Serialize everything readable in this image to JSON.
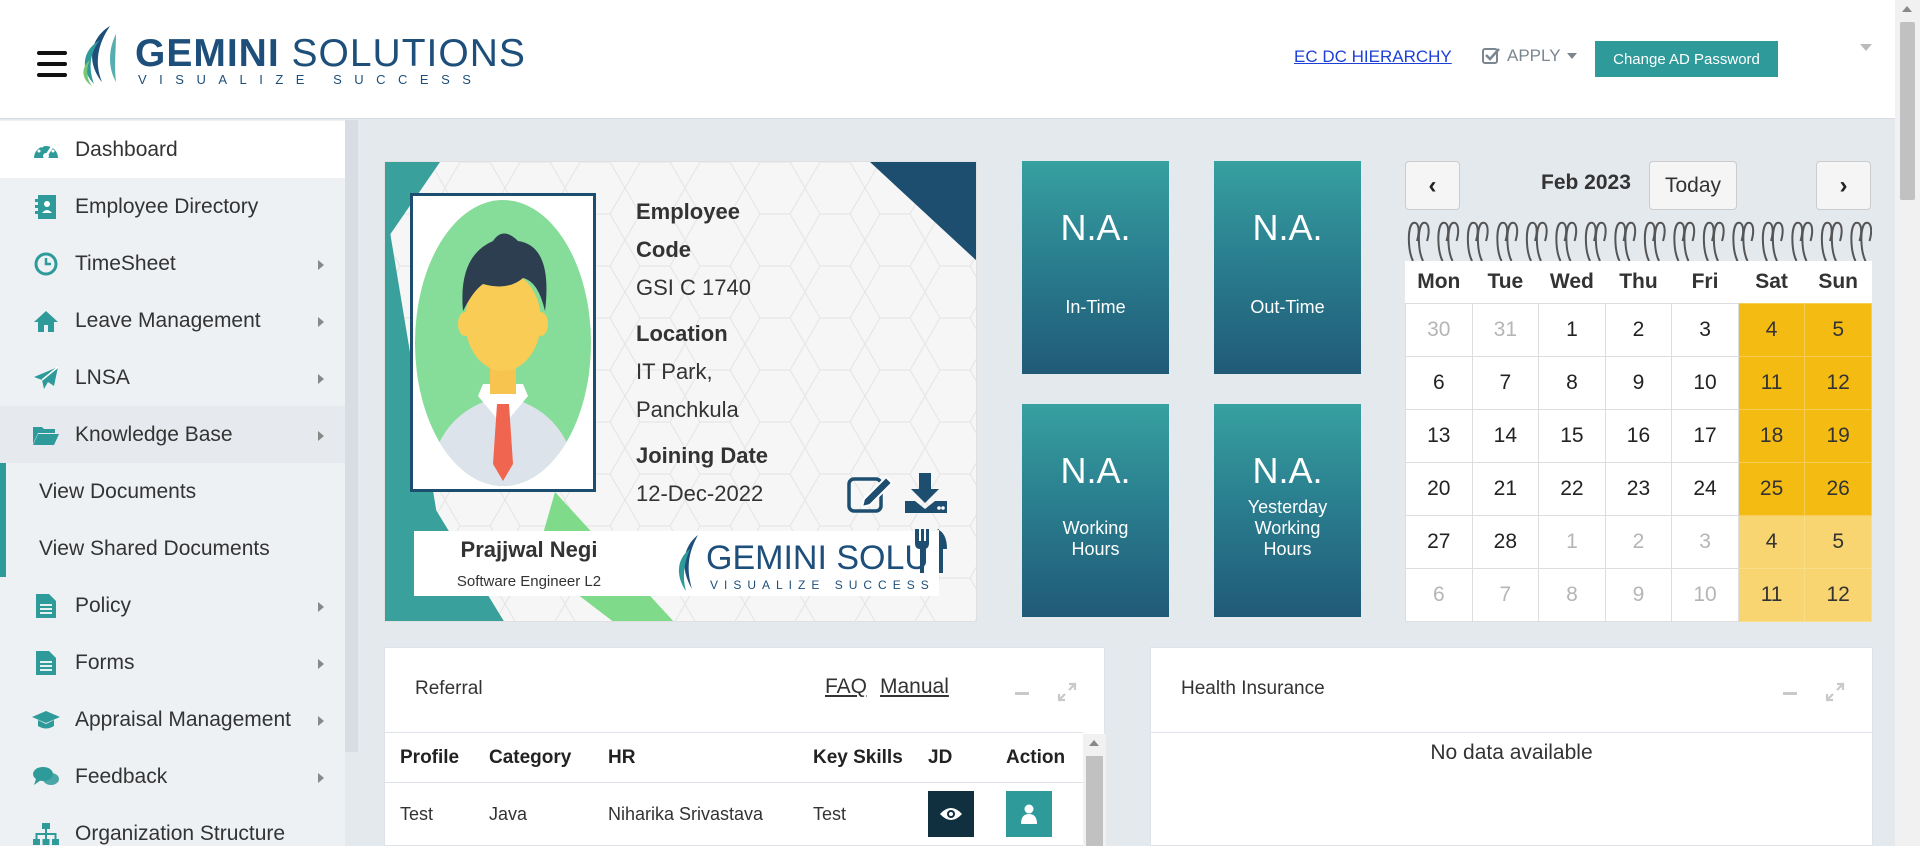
{
  "header": {
    "brand_main": "GEMINI",
    "brand_second": " SOLUTIONS",
    "brand_tagline": "VISUALIZE SUCCESS",
    "link_hierarchy": "EC DC HIERARCHY",
    "apply_label": "APPLY",
    "change_password_label": "Change AD Password"
  },
  "sidebar": {
    "items": [
      {
        "label": "Dashboard",
        "icon": "dashboard-gauge-icon"
      },
      {
        "label": "Employee Directory",
        "icon": "address-book-icon"
      },
      {
        "label": "TimeSheet",
        "icon": "clock-icon"
      },
      {
        "label": "Leave Management",
        "icon": "home-icon"
      },
      {
        "label": "LNSA",
        "icon": "paper-plane-icon"
      },
      {
        "label": "Knowledge Base",
        "icon": "folder-open-icon"
      },
      {
        "label": "View Documents"
      },
      {
        "label": "View Shared Documents"
      },
      {
        "label": "Policy",
        "icon": "document-icon"
      },
      {
        "label": "Forms",
        "icon": "document-icon"
      },
      {
        "label": "Appraisal Management",
        "icon": "graduation-cap-icon"
      },
      {
        "label": "Feedback",
        "icon": "comments-icon"
      },
      {
        "label": "Organization Structure",
        "icon": "sitemap-icon"
      }
    ]
  },
  "profile": {
    "employee_code_label_1": "Employee",
    "employee_code_label_2": "Code",
    "employee_code": "GSI C 1740",
    "location_label": "Location",
    "location_1": "IT Park,",
    "location_2": "Panchkula",
    "joining_label": "Joining Date",
    "joining_date": "12-Dec-2022",
    "name": "Prajjwal Negi",
    "designation": "Software Engineer L2",
    "card_logo_text": "GEMINI SOLUTIONS",
    "card_logo_tag": "VISUALIZE SUCCESS"
  },
  "tiles": [
    {
      "value": "N.A.",
      "label": "In-Time"
    },
    {
      "value": "N.A.",
      "label": "Out-Time"
    },
    {
      "value": "N.A.",
      "label_1": "Working",
      "label_2": "Hours"
    },
    {
      "value": "N.A.",
      "label_1": "Yesterday",
      "label_2": "Working",
      "label_3": "Hours"
    }
  ],
  "calendar": {
    "title": "Feb 2023",
    "today_label": "Today",
    "prev": "‹",
    "next": "›",
    "days": [
      "Mon",
      "Tue",
      "Wed",
      "Thu",
      "Fri",
      "Sat",
      "Sun"
    ],
    "weeks": [
      [
        {
          "d": "30",
          "t": "other"
        },
        {
          "d": "31",
          "t": "other"
        },
        {
          "d": "1"
        },
        {
          "d": "2"
        },
        {
          "d": "3"
        },
        {
          "d": "4",
          "t": "wk"
        },
        {
          "d": "5",
          "t": "wk"
        }
      ],
      [
        {
          "d": "6"
        },
        {
          "d": "7"
        },
        {
          "d": "8"
        },
        {
          "d": "9"
        },
        {
          "d": "10"
        },
        {
          "d": "11",
          "t": "wk"
        },
        {
          "d": "12",
          "t": "wk"
        }
      ],
      [
        {
          "d": "13"
        },
        {
          "d": "14"
        },
        {
          "d": "15"
        },
        {
          "d": "16"
        },
        {
          "d": "17"
        },
        {
          "d": "18",
          "t": "wk"
        },
        {
          "d": "19",
          "t": "wk"
        }
      ],
      [
        {
          "d": "20"
        },
        {
          "d": "21"
        },
        {
          "d": "22"
        },
        {
          "d": "23"
        },
        {
          "d": "24"
        },
        {
          "d": "25",
          "t": "wk"
        },
        {
          "d": "26",
          "t": "wk"
        }
      ],
      [
        {
          "d": "27"
        },
        {
          "d": "28"
        },
        {
          "d": "1",
          "t": "other"
        },
        {
          "d": "2",
          "t": "other"
        },
        {
          "d": "3",
          "t": "other"
        },
        {
          "d": "4",
          "t": "wk-light"
        },
        {
          "d": "5",
          "t": "wk-light"
        }
      ],
      [
        {
          "d": "6",
          "t": "other"
        },
        {
          "d": "7",
          "t": "other"
        },
        {
          "d": "8",
          "t": "other"
        },
        {
          "d": "9",
          "t": "other"
        },
        {
          "d": "10",
          "t": "other"
        },
        {
          "d": "11",
          "t": "wk-light"
        },
        {
          "d": "12",
          "t": "wk-light"
        }
      ]
    ]
  },
  "referral": {
    "title": "Referral",
    "faq": "FAQ",
    "manual": "Manual",
    "columns": [
      "Profile",
      "Category",
      "HR",
      "Key Skills",
      "JD",
      "Action"
    ],
    "rows": [
      {
        "profile": "Test",
        "category": "Java",
        "hr": "Niharika Srivastava",
        "skills": "Test"
      }
    ]
  },
  "health": {
    "title": "Health Insurance",
    "empty": "No data available"
  },
  "colors": {
    "accent": "#2e9a99",
    "brand_navy": "#1d4f7a",
    "weekend": "#f4bc12"
  }
}
